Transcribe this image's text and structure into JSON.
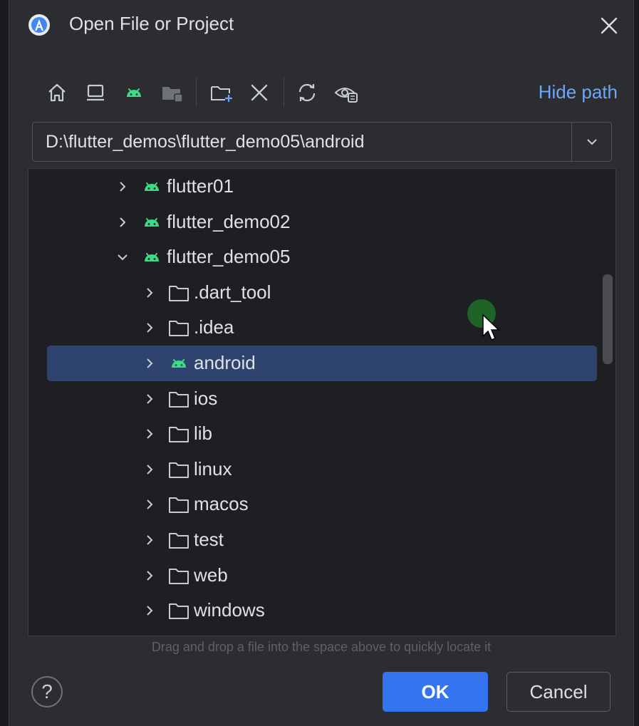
{
  "window": {
    "title": "Open File or Project"
  },
  "toolbar": {
    "buttons": [
      {
        "name": "home-icon"
      },
      {
        "name": "desktop-icon"
      },
      {
        "name": "android-project-icon"
      },
      {
        "name": "module-folder-icon"
      },
      {
        "name": "new-folder-icon"
      },
      {
        "name": "delete-icon"
      },
      {
        "name": "refresh-icon"
      },
      {
        "name": "show-hidden-icon"
      }
    ],
    "hide_path_label": "Hide path"
  },
  "path": {
    "value": "D:\\flutter_demos\\flutter_demo05\\android"
  },
  "tree": {
    "rows": [
      {
        "label": "flutter01",
        "icon": "android",
        "expanded": false,
        "depth": 0
      },
      {
        "label": "flutter_demo02",
        "icon": "android",
        "expanded": false,
        "depth": 0
      },
      {
        "label": "flutter_demo05",
        "icon": "android",
        "expanded": true,
        "depth": 0
      },
      {
        "label": ".dart_tool",
        "icon": "folder",
        "expanded": false,
        "depth": 1
      },
      {
        "label": ".idea",
        "icon": "folder",
        "expanded": false,
        "depth": 1
      },
      {
        "label": "android",
        "icon": "android",
        "expanded": false,
        "depth": 1,
        "selected": true
      },
      {
        "label": "ios",
        "icon": "folder",
        "expanded": false,
        "depth": 1
      },
      {
        "label": "lib",
        "icon": "folder",
        "expanded": false,
        "depth": 1
      },
      {
        "label": "linux",
        "icon": "folder",
        "expanded": false,
        "depth": 1
      },
      {
        "label": "macos",
        "icon": "folder",
        "expanded": false,
        "depth": 1
      },
      {
        "label": "test",
        "icon": "folder",
        "expanded": false,
        "depth": 1
      },
      {
        "label": "web",
        "icon": "folder",
        "expanded": false,
        "depth": 1
      },
      {
        "label": "windows",
        "icon": "folder",
        "expanded": false,
        "depth": 1
      }
    ]
  },
  "hint": "Drag and drop a file into the space above to quickly locate it",
  "footer": {
    "help_label": "?",
    "ok_label": "OK",
    "cancel_label": "Cancel"
  },
  "colors": {
    "accent": "#3574f0",
    "link": "#6ea6f7",
    "android_green": "#3ddc84",
    "selection": "#2e436e"
  }
}
